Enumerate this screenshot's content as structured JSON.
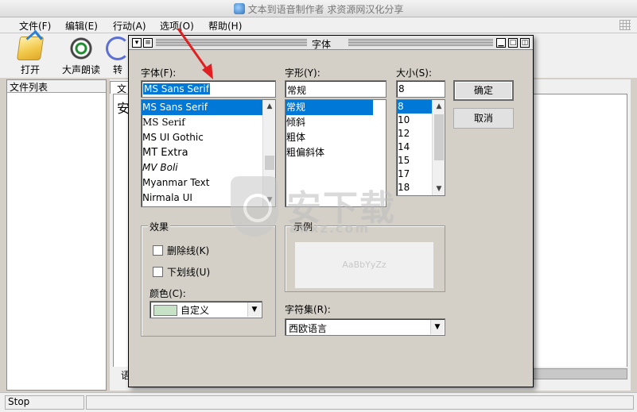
{
  "window": {
    "title": "文本到语音制作者 求资源网汉化分享"
  },
  "menu": [
    "文件(F)",
    "编辑(E)",
    "行动(A)",
    "选项(O)",
    "帮助(H)"
  ],
  "toolbar": {
    "open": "打开",
    "speak": "大声朗读",
    "third": "转"
  },
  "left_panel": {
    "header": "文件列表"
  },
  "main": {
    "tab": "文",
    "text": "安",
    "bottom_label": "语"
  },
  "status": {
    "text": "Stop"
  },
  "dialog": {
    "title": "字体",
    "font_label": "字体(F):",
    "font_value": "MS Sans Serif",
    "fonts": [
      "MS Sans Serif",
      "MS Serif",
      "MS UI Gothic",
      "MT Extra",
      "MV Boli",
      "Myanmar Text",
      "Nirmala UI"
    ],
    "style_label": "字形(Y):",
    "style_value": "常规",
    "styles": [
      "常规",
      "倾斜",
      "粗体",
      "粗偏斜体"
    ],
    "size_label": "大小(S):",
    "size_value": "8",
    "sizes": [
      "8",
      "10",
      "12",
      "14",
      "15",
      "17",
      "18"
    ],
    "ok": "确定",
    "cancel": "取消",
    "effects_label": "效果",
    "strikeout": "删除线(K)",
    "underline": "下划线(U)",
    "color_label": "颜色(C):",
    "color_value": "自定义",
    "sample_label": "示例",
    "sample_text": "AaBbYyZz",
    "charset_label": "字符集(R):",
    "charset_value": "西欧语言"
  },
  "watermark": {
    "text": "安下载",
    "url": "anxz.com"
  },
  "colors": {
    "selection": "#0078d7",
    "dialog_bg": "#d4d0c8",
    "swatch": "#c8e2c8",
    "arrow": "#e02020"
  }
}
